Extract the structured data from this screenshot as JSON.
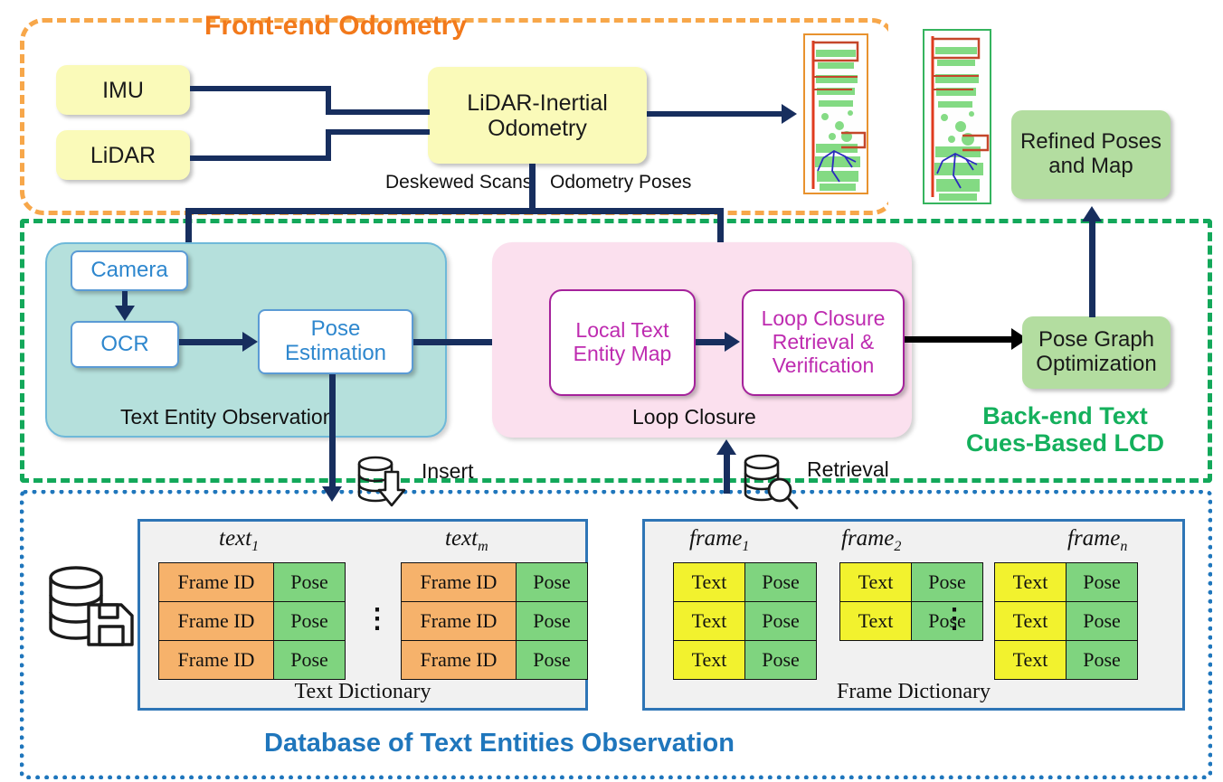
{
  "regions": {
    "frontend": {
      "title": "Front-end Odometry",
      "color": "#F2791B"
    },
    "backend": {
      "title_line1": "Back-end Text",
      "title_line2": "Cues-Based LCD",
      "color": "#14B05C"
    },
    "database": {
      "title": "Database of Text Entities Observation",
      "color": "#1F76BC"
    }
  },
  "nodes": {
    "imu": "IMU",
    "lidar": "LiDAR",
    "lio_line1": "LiDAR-Inertial",
    "lio_line2": "Odometry",
    "camera": "Camera",
    "ocr": "OCR",
    "pose_estimation_line1": "Pose",
    "pose_estimation_line2": "Estimation",
    "local_text_map_line1": "Local Text",
    "local_text_map_line2": "Entity Map",
    "loop_closure_rv_line1": "Loop Closure",
    "loop_closure_rv_line2": "Retrieval &",
    "loop_closure_rv_line3": "Verification",
    "pose_graph_line1": "Pose Graph",
    "pose_graph_line2": "Optimization",
    "refined_line1": "Refined Poses",
    "refined_line2": "and Map"
  },
  "panels": {
    "text_entity_observation": "Text Entity Observation",
    "loop_closure": "Loop Closure"
  },
  "edges": {
    "deskewed_scans": "Deskewed Scans",
    "odometry_poses": "Odometry Poses",
    "insert": "Insert",
    "retrieval": "Retrieval"
  },
  "icons": {
    "db_save": "database-save-icon",
    "db_insert": "database-insert-icon",
    "db_retrieval": "database-search-icon",
    "pointcloud_front": "pointcloud-map-front-icon",
    "pointcloud_back": "pointcloud-map-back-icon"
  },
  "text_dictionary": {
    "title": "Text Dictionary",
    "groups": [
      {
        "label": "text",
        "sub": "1",
        "col_left": "Frame ID",
        "col_right": "Pose",
        "rows": 3
      },
      {
        "label": "text",
        "sub": "m",
        "col_left": "Frame ID",
        "col_right": "Pose",
        "rows": 3
      }
    ],
    "ellipsis": "⋮"
  },
  "frame_dictionary": {
    "title": "Frame Dictionary",
    "groups": [
      {
        "label": "frame",
        "sub": "1",
        "col_left": "Text",
        "col_right": "Pose",
        "rows": 3
      },
      {
        "label": "frame",
        "sub": "2",
        "col_left": "Text",
        "col_right": "Pose",
        "rows": 2
      },
      {
        "label": "frame",
        "sub": "n",
        "col_left": "Text",
        "col_right": "Pose",
        "rows": 3
      }
    ],
    "ellipsis": "⋮"
  },
  "colors": {
    "navy": "#172E5E",
    "yellow_node": "#FAFAB9",
    "teal_panel": "#B5E0DC",
    "pink_panel": "#FBE0EE",
    "green_node": "#B3DDA0",
    "purple_border": "#A5229B",
    "blue_border": "#5B9BD5",
    "orange_cell": "#F6B26B",
    "green_cell": "#7FD47F",
    "yellow_cell": "#F2F22E"
  }
}
